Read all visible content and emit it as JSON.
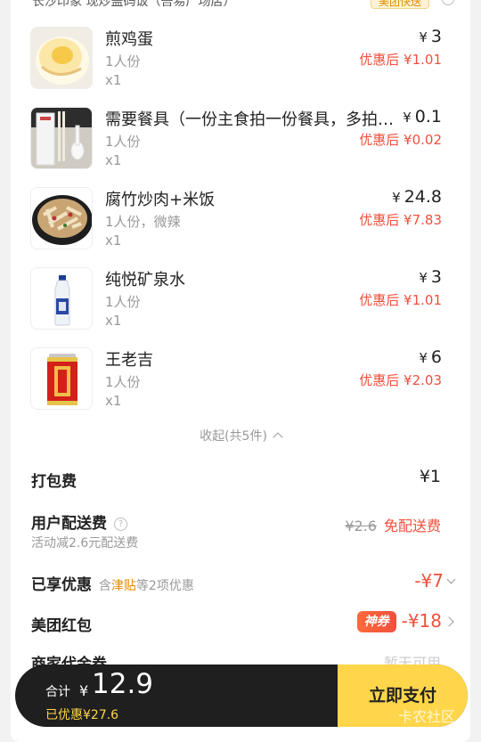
{
  "store": {
    "name": "长沙印象 现炒盖码饭（吾易广场店）",
    "fast_badge": "美团快送"
  },
  "items": [
    {
      "name": "煎鸡蛋",
      "spec": "1人份",
      "qty": "x1",
      "price": "3",
      "discount": "优惠后 ¥1.01"
    },
    {
      "name": "需要餐具（一份主食拍一份餐具，多拍…",
      "spec": "1人份",
      "qty": "x1",
      "price": "0.1",
      "discount": "优惠后 ¥0.02"
    },
    {
      "name": "腐竹炒肉+米饭",
      "spec": "1人份，微辣",
      "qty": "x1",
      "price": "24.8",
      "discount": "优惠后 ¥7.83"
    },
    {
      "name": "纯悦矿泉水",
      "spec": "1人份",
      "qty": "x1",
      "price": "3",
      "discount": "优惠后 ¥1.01"
    },
    {
      "name": "王老吉",
      "spec": "1人份",
      "qty": "x1",
      "price": "6",
      "discount": "优惠后 ¥2.03"
    }
  ],
  "yen": "¥",
  "collapse_label": "收起(共5件)",
  "packing": {
    "label": "打包费",
    "value": "¥1"
  },
  "delivery": {
    "label": "用户配送费",
    "note": "活动减2.6元配送费",
    "original": "¥2.6",
    "free": "免配送费"
  },
  "enjoyed": {
    "label": "已享优惠",
    "prefix": "含",
    "highlight": "津贴",
    "suffix": "等2项优惠",
    "value": "-¥7"
  },
  "redpack": {
    "label": "美团红包",
    "badge": "神券",
    "value": "-¥18"
  },
  "partial": {
    "label": "商家代金券",
    "value": "暂无可用"
  },
  "paybar": {
    "total_label": "合计",
    "total_yen": "¥",
    "total_amount": "12.9",
    "saved": "已优惠¥27.6",
    "pay_label": "立即支付"
  },
  "watermark": "卡农社区",
  "colors": {
    "accent_red": "#f0503c",
    "pay_yellow": "#ffd64a",
    "bar_dark": "#1f1f1f"
  }
}
